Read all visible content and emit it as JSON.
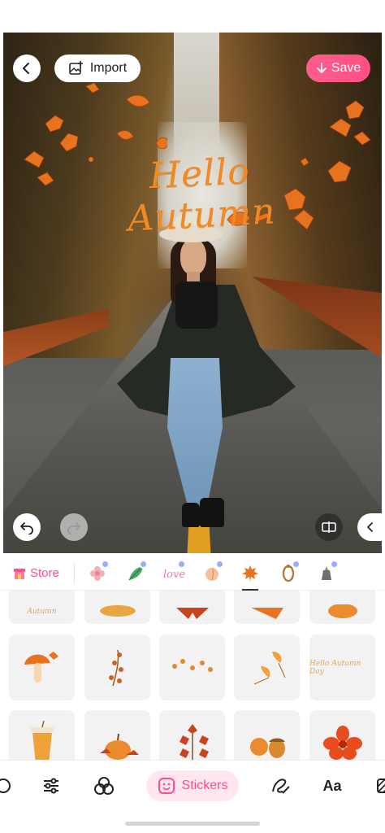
{
  "header": {
    "import_label": "Import",
    "save_label": "Save"
  },
  "canvas": {
    "overlay_text": "Hello Autumn"
  },
  "sticker_bar": {
    "store_label": "Store",
    "categories": [
      {
        "icon": "flower-sticker-icon"
      },
      {
        "icon": "leaf-sticker-icon"
      },
      {
        "icon": "love-sticker-icon",
        "text": "love"
      },
      {
        "icon": "peach-sticker-icon"
      },
      {
        "icon": "maple-leaf-sticker-icon"
      },
      {
        "icon": "frame-sticker-icon"
      },
      {
        "icon": "lamp-sticker-icon"
      }
    ]
  },
  "sticker_grid": {
    "row1_texts": [
      "Autumn"
    ],
    "row2_text": "Hello Autumn Day"
  },
  "toolbar": {
    "stickers_label": "Stickers",
    "text_tool_label": "Aa"
  },
  "colors": {
    "accent": "#ff4f83",
    "overlay_text": "#f08a24",
    "sticker_orange": "#e8731f"
  }
}
